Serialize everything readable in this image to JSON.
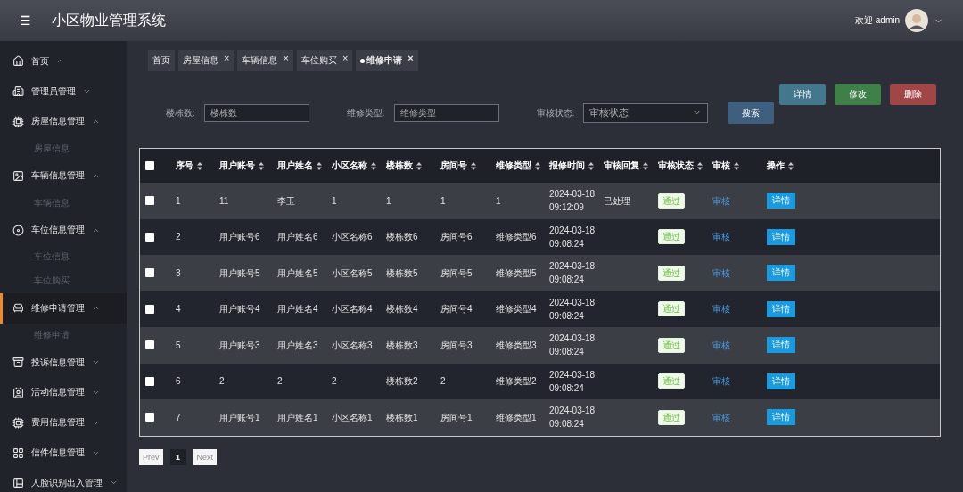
{
  "header": {
    "menu_glyph": "☰",
    "title": "小区物业管理系统",
    "welcome": "欢迎 admin"
  },
  "sidebar": {
    "items": [
      {
        "label": "首页",
        "expanded": true,
        "selected": false
      },
      {
        "label": "管理员管理",
        "expanded": false,
        "selected": false
      },
      {
        "label": "房屋信息管理",
        "expanded": true,
        "selected": false,
        "children": [
          {
            "label": "房屋信息"
          }
        ]
      },
      {
        "label": "车辆信息管理",
        "expanded": true,
        "selected": false,
        "children": [
          {
            "label": "车辆信息"
          }
        ]
      },
      {
        "label": "车位信息管理",
        "expanded": true,
        "selected": false,
        "children": [
          {
            "label": "车位信息"
          },
          {
            "label": "车位购买"
          }
        ]
      },
      {
        "label": "维修申请管理",
        "expanded": true,
        "selected": true,
        "children": [
          {
            "label": "维修申请"
          }
        ]
      },
      {
        "label": "投诉信息管理",
        "expanded": false,
        "selected": false
      },
      {
        "label": "活动信息管理",
        "expanded": false,
        "selected": false
      },
      {
        "label": "费用信息管理",
        "expanded": false,
        "selected": false
      },
      {
        "label": "信件信息管理",
        "expanded": false,
        "selected": false
      },
      {
        "label": "人脸识别出入管理",
        "expanded": false,
        "selected": false
      }
    ]
  },
  "tabs": [
    {
      "label": "首页",
      "closable": false,
      "selected": false
    },
    {
      "label": "房屋信息",
      "closable": true,
      "selected": false
    },
    {
      "label": "车辆信息",
      "closable": true,
      "selected": false
    },
    {
      "label": "车位购买",
      "closable": true,
      "selected": false
    },
    {
      "label": "维修申请",
      "closable": true,
      "selected": true
    }
  ],
  "close_glyph": "×",
  "actions": [
    {
      "label": "详情",
      "kind": "info"
    },
    {
      "label": "修改",
      "kind": "edit"
    },
    {
      "label": "删除",
      "kind": "delete"
    }
  ],
  "search": {
    "fields": [
      {
        "label": "楼栋数:",
        "placeholder": "楼栋数",
        "kind": "text"
      },
      {
        "label": "维修类型:",
        "placeholder": "维修类型",
        "kind": "text"
      },
      {
        "label": "审核状态:",
        "placeholder": "审核状态",
        "kind": "select"
      }
    ],
    "button": "搜索"
  },
  "table": {
    "columns": [
      {
        "label": "序号"
      },
      {
        "label": "用户账号"
      },
      {
        "label": "用户姓名"
      },
      {
        "label": "小区名称"
      },
      {
        "label": "楼栋数"
      },
      {
        "label": "房间号"
      },
      {
        "label": "维修类型"
      },
      {
        "label": "报修时间"
      },
      {
        "label": "审核回复"
      },
      {
        "label": "审核状态"
      },
      {
        "label": "审核"
      },
      {
        "label": "操作"
      }
    ],
    "header_checked": false,
    "rows": [
      {
        "checked": false,
        "cells": [
          "1",
          "11",
          "李玉",
          "1",
          "1",
          "1",
          "1",
          "2024-03-18 09:12:09"
        ],
        "reply": "已处理",
        "status": "通过",
        "review": "审核",
        "action": "详情"
      },
      {
        "checked": false,
        "cells": [
          "2",
          "用户账号6",
          "用户姓名6",
          "小区名称6",
          "楼栋数6",
          "房间号6",
          "维修类型6",
          "2024-03-18 09:08:24"
        ],
        "status": "通过",
        "review": "审核",
        "action": "详情"
      },
      {
        "checked": false,
        "cells": [
          "3",
          "用户账号5",
          "用户姓名5",
          "小区名称5",
          "楼栋数5",
          "房间号5",
          "维修类型5",
          "2024-03-18 09:08:24"
        ],
        "status": "通过",
        "review": "审核",
        "action": "详情"
      },
      {
        "checked": false,
        "cells": [
          "4",
          "用户账号4",
          "用户姓名4",
          "小区名称4",
          "楼栋数4",
          "房间号4",
          "维修类型4",
          "2024-03-18 09:08:24"
        ],
        "status": "通过",
        "review": "审核",
        "action": "详情"
      },
      {
        "checked": false,
        "cells": [
          "5",
          "用户账号3",
          "用户姓名3",
          "小区名称3",
          "楼栋数3",
          "房间号3",
          "维修类型3",
          "2024-03-18 09:08:24"
        ],
        "status": "通过",
        "review": "审核",
        "action": "详情"
      },
      {
        "checked": false,
        "cells": [
          "6",
          "2",
          "2",
          "2",
          "楼栋数2",
          "2",
          "维修类型2",
          "2024-03-18 09:08:24"
        ],
        "status": "通过",
        "review": "审核",
        "action": "详情"
      },
      {
        "checked": false,
        "cells": [
          "7",
          "用户账号1",
          "用户姓名1",
          "小区名称1",
          "楼栋数1",
          "房间号1",
          "维修类型1",
          "2024-03-18 09:08:24"
        ],
        "status": "通过",
        "review": "审核",
        "action": "详情"
      }
    ]
  },
  "pagination": {
    "prev": {
      "label": "Prev",
      "disabled": true
    },
    "pages": [
      {
        "label": "1",
        "selected": true
      }
    ],
    "next": {
      "label": "Next",
      "disabled": true
    }
  }
}
